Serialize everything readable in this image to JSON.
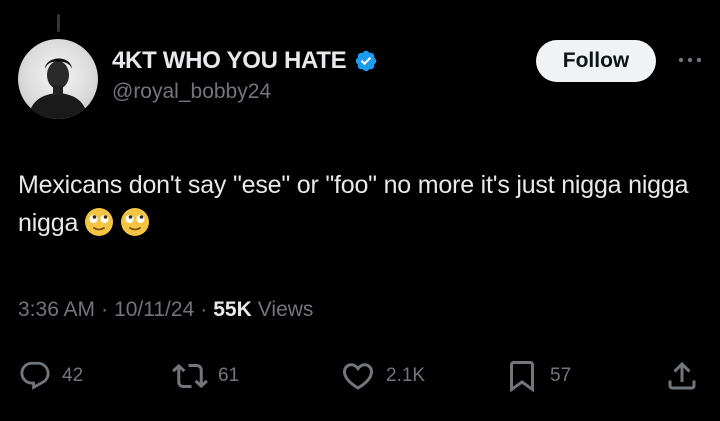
{
  "author": {
    "display_name": "4KT WHO YOU HATE",
    "handle": "@royal_bobby24",
    "verified": true,
    "verified_color": "#1d9bf0"
  },
  "follow_button": {
    "label": "Follow"
  },
  "tweet": {
    "text": "Mexicans don't say \"ese\" or \"foo\" no more it's just nigga nigga nigga",
    "emojis": [
      "rolling-eyes-face-emoji",
      "rolling-eyes-face-emoji"
    ]
  },
  "meta": {
    "time": "3:36 AM",
    "separator": "·",
    "date": "10/11/24",
    "views_count": "55K",
    "views_label": "Views"
  },
  "actions": {
    "replies": "42",
    "reposts": "61",
    "likes": "2.1K",
    "bookmarks": "57"
  },
  "colors": {
    "background": "#000000",
    "primary_text": "#e7e9ea",
    "secondary_text": "#71767b",
    "follow_bg": "#eff3f4"
  }
}
